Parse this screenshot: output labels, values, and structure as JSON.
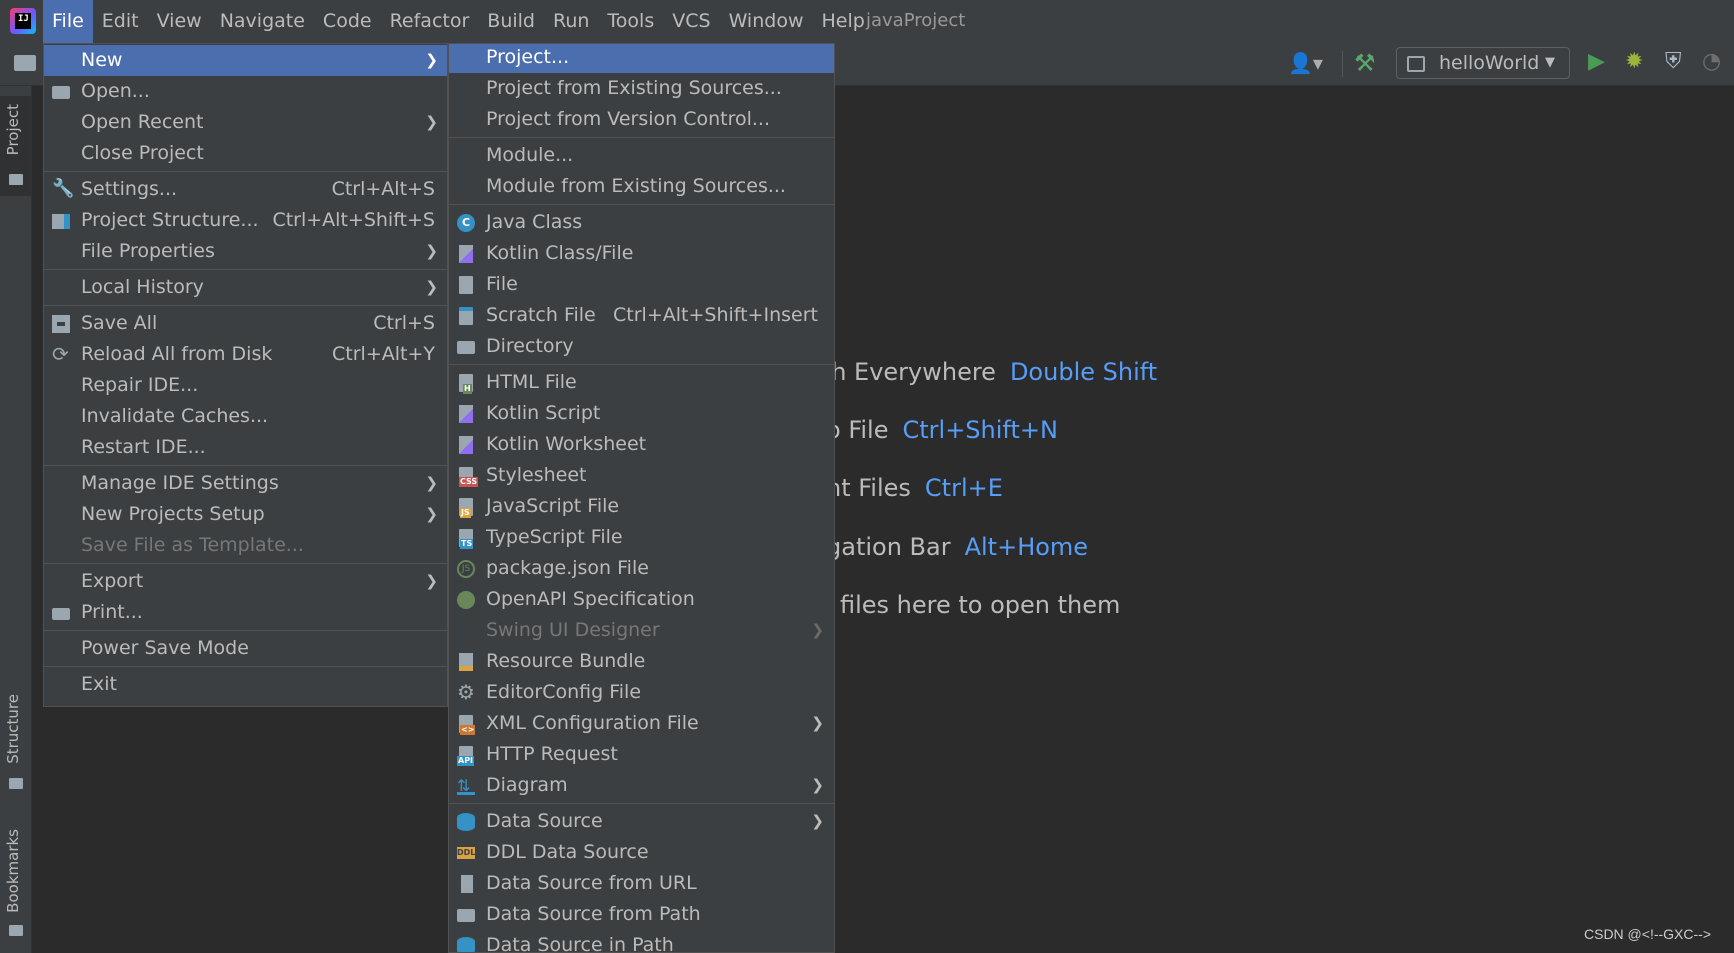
{
  "window_title": "javaProject",
  "menubar": [
    {
      "label": "File",
      "active": true
    },
    {
      "label": "Edit"
    },
    {
      "label": "View"
    },
    {
      "label": "Navigate"
    },
    {
      "label": "Code"
    },
    {
      "label": "Refactor"
    },
    {
      "label": "Build"
    },
    {
      "label": "Run"
    },
    {
      "label": "Tools"
    },
    {
      "label": "VCS"
    },
    {
      "label": "Window"
    },
    {
      "label": "Help"
    }
  ],
  "toolbar": {
    "run_config": "helloWorld",
    "icons": [
      "folder-icon",
      "user-icon",
      "hammer-icon",
      "run-icon",
      "debug-icon",
      "coverage-icon",
      "profile-icon"
    ]
  },
  "tool_strip": {
    "project": "Project",
    "structure": "Structure",
    "bookmarks": "Bookmarks"
  },
  "editor_hints": [
    {
      "text": "ch Everywhere",
      "key": "Double Shift"
    },
    {
      "text": "o File",
      "key": "Ctrl+Shift+N"
    },
    {
      "text": "nt Files",
      "key": "Ctrl+E"
    },
    {
      "text": "gation Bar",
      "key": "Alt+Home"
    },
    {
      "text": "files here to open them",
      "key": ""
    }
  ],
  "file_menu": {
    "items": [
      {
        "label": "New",
        "submenu": true,
        "highlight": true
      },
      {
        "label": "Open...",
        "icon": "folder-open-icon"
      },
      {
        "label": "Open Recent",
        "submenu": true
      },
      {
        "label": "Close Project"
      },
      {
        "label": "Settings...",
        "shortcut": "Ctrl+Alt+S",
        "icon": "wrench-icon"
      },
      {
        "label": "Project Structure...",
        "shortcut": "Ctrl+Alt+Shift+S",
        "icon": "project-structure-icon"
      },
      {
        "label": "File Properties",
        "submenu": true
      },
      {
        "label": "Local History",
        "submenu": true
      },
      {
        "label": "Save All",
        "shortcut": "Ctrl+S",
        "icon": "save-icon"
      },
      {
        "label": "Reload All from Disk",
        "shortcut": "Ctrl+Alt+Y",
        "icon": "reload-icon"
      },
      {
        "label": "Repair IDE..."
      },
      {
        "label": "Invalidate Caches..."
      },
      {
        "label": "Restart IDE..."
      },
      {
        "label": "Manage IDE Settings",
        "submenu": true
      },
      {
        "label": "New Projects Setup",
        "submenu": true
      },
      {
        "label": "Save File as Template...",
        "disabled": true
      },
      {
        "label": "Export",
        "submenu": true
      },
      {
        "label": "Print...",
        "icon": "printer-icon"
      },
      {
        "label": "Power Save Mode"
      },
      {
        "label": "Exit"
      }
    ]
  },
  "new_menu": {
    "items": [
      {
        "label": "Project...",
        "highlight": true
      },
      {
        "label": "Project from Existing Sources..."
      },
      {
        "label": "Project from Version Control..."
      },
      {
        "label": "Module..."
      },
      {
        "label": "Module from Existing Sources..."
      },
      {
        "label": "Java Class",
        "icon": "java-class-icon",
        "badge": "C"
      },
      {
        "label": "Kotlin Class/File",
        "icon": "kotlin-icon"
      },
      {
        "label": "File",
        "icon": "file-icon"
      },
      {
        "label": "Scratch File",
        "shortcut": "Ctrl+Alt+Shift+Insert",
        "icon": "scratch-file-icon"
      },
      {
        "label": "Directory",
        "icon": "directory-icon"
      },
      {
        "label": "HTML File",
        "icon": "html-file-icon",
        "badge": "H"
      },
      {
        "label": "Kotlin Script",
        "icon": "kotlin-icon"
      },
      {
        "label": "Kotlin Worksheet",
        "icon": "kotlin-icon"
      },
      {
        "label": "Stylesheet",
        "icon": "css-file-icon",
        "badge": "CSS"
      },
      {
        "label": "JavaScript File",
        "icon": "js-file-icon",
        "badge": "JS"
      },
      {
        "label": "TypeScript File",
        "icon": "ts-file-icon",
        "badge": "TS"
      },
      {
        "label": "package.json File",
        "icon": "package-json-icon",
        "badge": "JS"
      },
      {
        "label": "OpenAPI Specification",
        "icon": "openapi-icon"
      },
      {
        "label": "Swing UI Designer",
        "submenu": true,
        "disabled": true
      },
      {
        "label": "Resource Bundle",
        "icon": "resource-bundle-icon"
      },
      {
        "label": "EditorConfig File",
        "icon": "gear-icon"
      },
      {
        "label": "XML Configuration File",
        "submenu": true,
        "icon": "xml-file-icon",
        "badge": "<>"
      },
      {
        "label": "HTTP Request",
        "icon": "http-request-icon",
        "badge": "API"
      },
      {
        "label": "Diagram",
        "submenu": true,
        "icon": "diagram-icon"
      },
      {
        "label": "Data Source",
        "submenu": true,
        "icon": "database-icon"
      },
      {
        "label": "DDL Data Source",
        "icon": "ddl-icon",
        "badge": "DDL"
      },
      {
        "label": "Data Source from URL",
        "icon": "url-icon"
      },
      {
        "label": "Data Source from Path",
        "icon": "folder-open-icon"
      },
      {
        "label": "Data Source in Path",
        "icon": "database-icon"
      }
    ]
  },
  "watermark": "CSDN @<!--GXC-->"
}
